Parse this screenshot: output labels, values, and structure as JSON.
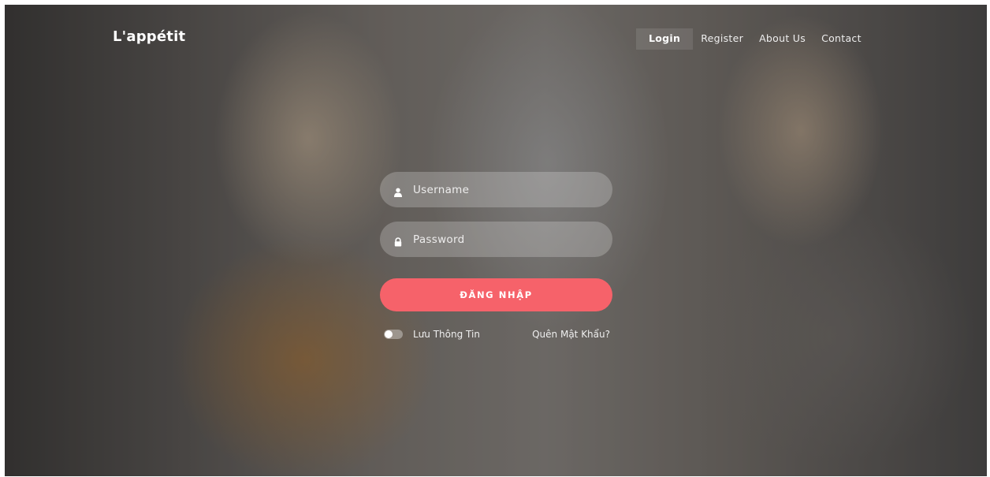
{
  "brand": "L'appétit",
  "nav": {
    "login": "Login",
    "register": "Register",
    "about": "About Us",
    "contact": "Contact"
  },
  "form": {
    "username_placeholder": "Username",
    "password_placeholder": "Password",
    "submit_label": "ĐĂNG NHẬP",
    "remember_label": "Lưu Thông Tin",
    "remember_checked": false,
    "forgot_label": "Quên Mật Khẩu?"
  },
  "colors": {
    "accent": "#f6626a"
  },
  "icons": {
    "username": "user-icon",
    "password": "lock-icon"
  }
}
